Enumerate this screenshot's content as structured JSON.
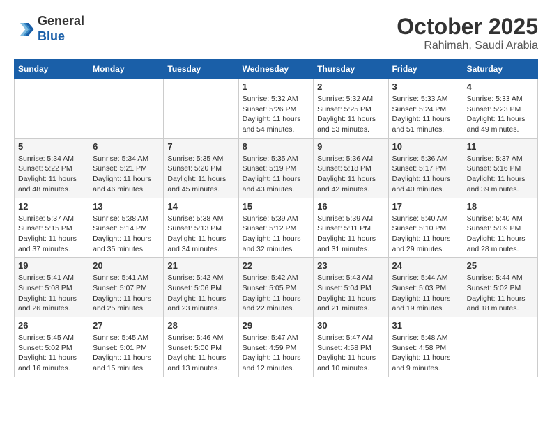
{
  "header": {
    "logo_general": "General",
    "logo_blue": "Blue",
    "month": "October 2025",
    "location": "Rahimah, Saudi Arabia"
  },
  "weekdays": [
    "Sunday",
    "Monday",
    "Tuesday",
    "Wednesday",
    "Thursday",
    "Friday",
    "Saturday"
  ],
  "weeks": [
    [
      {
        "day": "",
        "info": ""
      },
      {
        "day": "",
        "info": ""
      },
      {
        "day": "",
        "info": ""
      },
      {
        "day": "1",
        "info": "Sunrise: 5:32 AM\nSunset: 5:26 PM\nDaylight: 11 hours\nand 54 minutes."
      },
      {
        "day": "2",
        "info": "Sunrise: 5:32 AM\nSunset: 5:25 PM\nDaylight: 11 hours\nand 53 minutes."
      },
      {
        "day": "3",
        "info": "Sunrise: 5:33 AM\nSunset: 5:24 PM\nDaylight: 11 hours\nand 51 minutes."
      },
      {
        "day": "4",
        "info": "Sunrise: 5:33 AM\nSunset: 5:23 PM\nDaylight: 11 hours\nand 49 minutes."
      }
    ],
    [
      {
        "day": "5",
        "info": "Sunrise: 5:34 AM\nSunset: 5:22 PM\nDaylight: 11 hours\nand 48 minutes."
      },
      {
        "day": "6",
        "info": "Sunrise: 5:34 AM\nSunset: 5:21 PM\nDaylight: 11 hours\nand 46 minutes."
      },
      {
        "day": "7",
        "info": "Sunrise: 5:35 AM\nSunset: 5:20 PM\nDaylight: 11 hours\nand 45 minutes."
      },
      {
        "day": "8",
        "info": "Sunrise: 5:35 AM\nSunset: 5:19 PM\nDaylight: 11 hours\nand 43 minutes."
      },
      {
        "day": "9",
        "info": "Sunrise: 5:36 AM\nSunset: 5:18 PM\nDaylight: 11 hours\nand 42 minutes."
      },
      {
        "day": "10",
        "info": "Sunrise: 5:36 AM\nSunset: 5:17 PM\nDaylight: 11 hours\nand 40 minutes."
      },
      {
        "day": "11",
        "info": "Sunrise: 5:37 AM\nSunset: 5:16 PM\nDaylight: 11 hours\nand 39 minutes."
      }
    ],
    [
      {
        "day": "12",
        "info": "Sunrise: 5:37 AM\nSunset: 5:15 PM\nDaylight: 11 hours\nand 37 minutes."
      },
      {
        "day": "13",
        "info": "Sunrise: 5:38 AM\nSunset: 5:14 PM\nDaylight: 11 hours\nand 35 minutes."
      },
      {
        "day": "14",
        "info": "Sunrise: 5:38 AM\nSunset: 5:13 PM\nDaylight: 11 hours\nand 34 minutes."
      },
      {
        "day": "15",
        "info": "Sunrise: 5:39 AM\nSunset: 5:12 PM\nDaylight: 11 hours\nand 32 minutes."
      },
      {
        "day": "16",
        "info": "Sunrise: 5:39 AM\nSunset: 5:11 PM\nDaylight: 11 hours\nand 31 minutes."
      },
      {
        "day": "17",
        "info": "Sunrise: 5:40 AM\nSunset: 5:10 PM\nDaylight: 11 hours\nand 29 minutes."
      },
      {
        "day": "18",
        "info": "Sunrise: 5:40 AM\nSunset: 5:09 PM\nDaylight: 11 hours\nand 28 minutes."
      }
    ],
    [
      {
        "day": "19",
        "info": "Sunrise: 5:41 AM\nSunset: 5:08 PM\nDaylight: 11 hours\nand 26 minutes."
      },
      {
        "day": "20",
        "info": "Sunrise: 5:41 AM\nSunset: 5:07 PM\nDaylight: 11 hours\nand 25 minutes."
      },
      {
        "day": "21",
        "info": "Sunrise: 5:42 AM\nSunset: 5:06 PM\nDaylight: 11 hours\nand 23 minutes."
      },
      {
        "day": "22",
        "info": "Sunrise: 5:42 AM\nSunset: 5:05 PM\nDaylight: 11 hours\nand 22 minutes."
      },
      {
        "day": "23",
        "info": "Sunrise: 5:43 AM\nSunset: 5:04 PM\nDaylight: 11 hours\nand 21 minutes."
      },
      {
        "day": "24",
        "info": "Sunrise: 5:44 AM\nSunset: 5:03 PM\nDaylight: 11 hours\nand 19 minutes."
      },
      {
        "day": "25",
        "info": "Sunrise: 5:44 AM\nSunset: 5:02 PM\nDaylight: 11 hours\nand 18 minutes."
      }
    ],
    [
      {
        "day": "26",
        "info": "Sunrise: 5:45 AM\nSunset: 5:02 PM\nDaylight: 11 hours\nand 16 minutes."
      },
      {
        "day": "27",
        "info": "Sunrise: 5:45 AM\nSunset: 5:01 PM\nDaylight: 11 hours\nand 15 minutes."
      },
      {
        "day": "28",
        "info": "Sunrise: 5:46 AM\nSunset: 5:00 PM\nDaylight: 11 hours\nand 13 minutes."
      },
      {
        "day": "29",
        "info": "Sunrise: 5:47 AM\nSunset: 4:59 PM\nDaylight: 11 hours\nand 12 minutes."
      },
      {
        "day": "30",
        "info": "Sunrise: 5:47 AM\nSunset: 4:58 PM\nDaylight: 11 hours\nand 10 minutes."
      },
      {
        "day": "31",
        "info": "Sunrise: 5:48 AM\nSunset: 4:58 PM\nDaylight: 11 hours\nand 9 minutes."
      },
      {
        "day": "",
        "info": ""
      }
    ]
  ]
}
